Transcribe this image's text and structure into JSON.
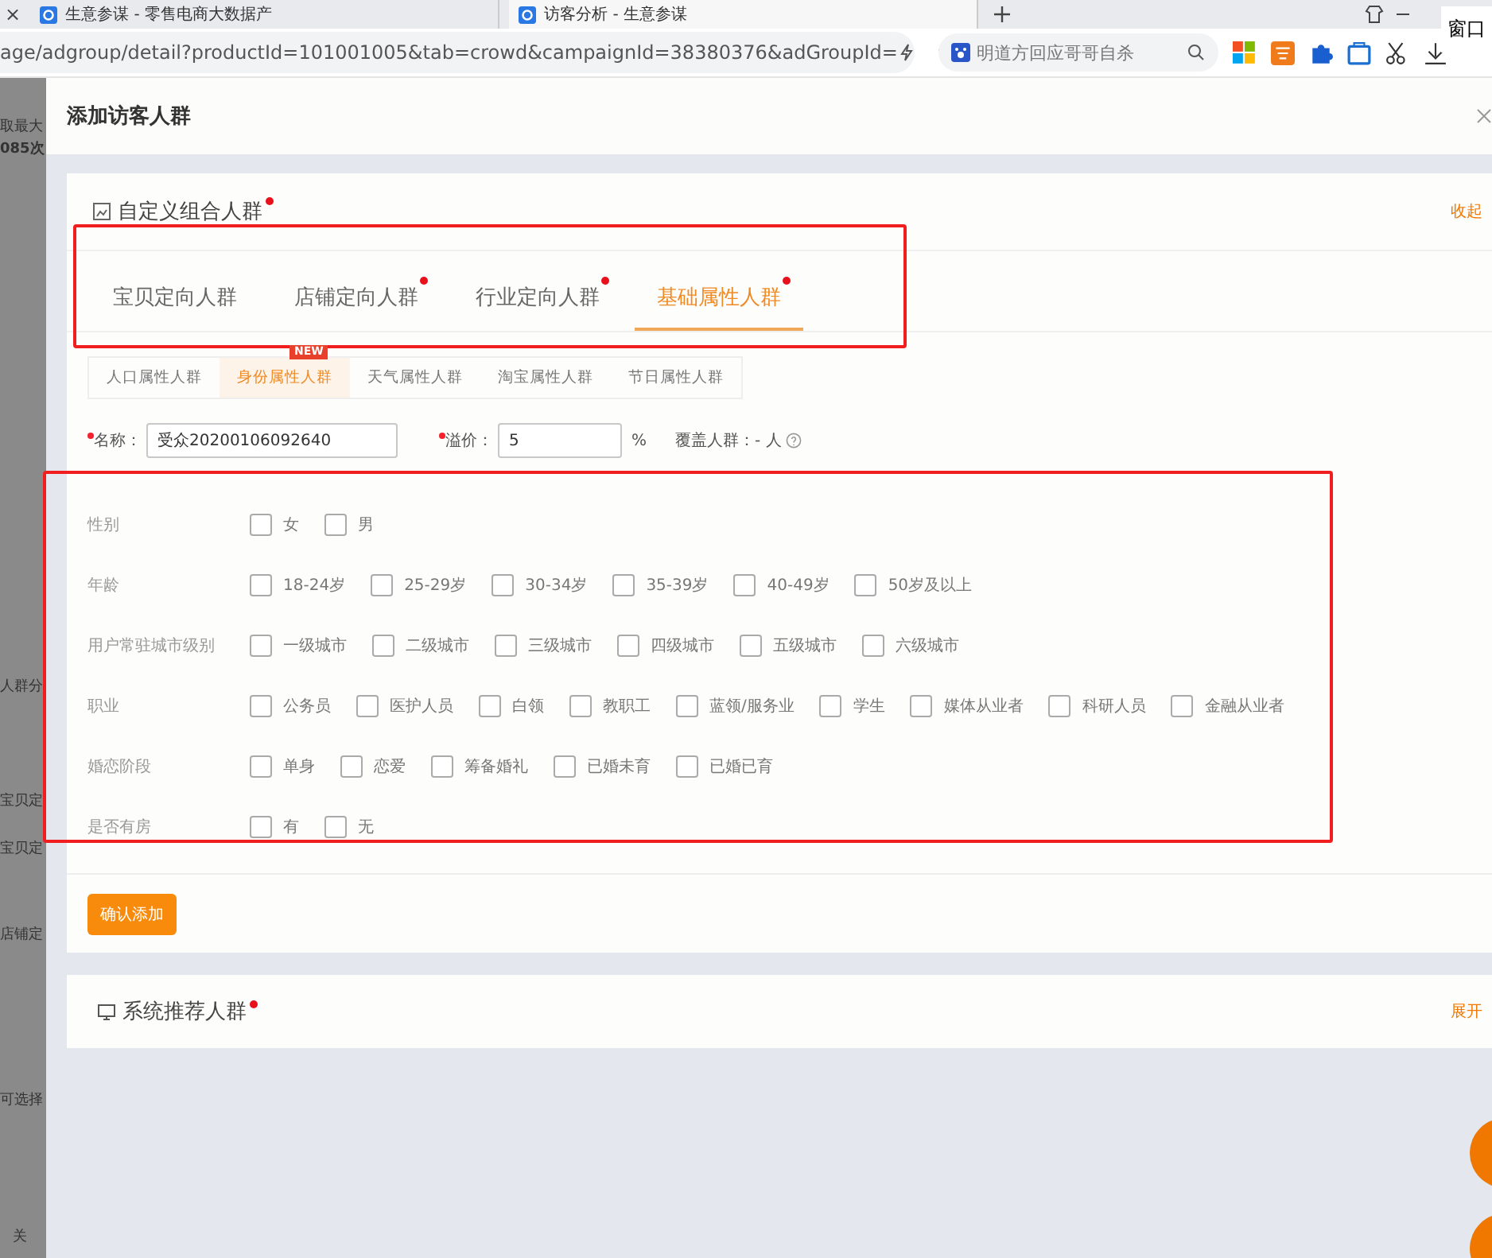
{
  "browser": {
    "close_tab": "×",
    "tabs": [
      {
        "title": "生意参谋 - 零售电商大数据产",
        "selected": false
      },
      {
        "title": "访客分析 - 生意参谋",
        "selected": true
      }
    ],
    "address": "age/adgroup/detail?productId=101001005&tab=crowd&campaignId=38380376&adGroupId=",
    "search": "明道方回应哥哥自杀",
    "window_label": "窗口"
  },
  "background_page": [
    "取最大",
    "085次",
    "人群分",
    "宝贝定",
    "宝贝定",
    "店铺定",
    "可选择",
    "关"
  ],
  "dialog": {
    "title": "添加访客人群",
    "custom_card": {
      "title": "自定义组合人群",
      "toggle": "收起",
      "tabs": [
        {
          "label": "宝贝定向人群",
          "selected": false,
          "dot": false
        },
        {
          "label": "店铺定向人群",
          "selected": false,
          "dot": true
        },
        {
          "label": "行业定向人群",
          "selected": false,
          "dot": true
        },
        {
          "label": "基础属性人群",
          "selected": true,
          "dot": true
        }
      ],
      "subtabs": [
        {
          "label": "人口属性人群",
          "selected": false
        },
        {
          "label": "身份属性人群",
          "selected": true,
          "badge": "NEW"
        },
        {
          "label": "天气属性人群",
          "selected": false
        },
        {
          "label": "淘宝属性人群",
          "selected": false
        },
        {
          "label": "节日属性人群",
          "selected": false
        }
      ],
      "name_label": "名称：",
      "name_value": "受众20200106092640",
      "premium_label": "溢价：",
      "premium_value": "5",
      "percent": "%",
      "coverage": "覆盖人群：- 人",
      "groups": [
        {
          "label": "性别",
          "options": [
            {
              "label": "女",
              "checked": false
            },
            {
              "label": "男",
              "checked": false
            }
          ]
        },
        {
          "label": "年龄",
          "options": [
            {
              "label": "18-24岁",
              "checked": false
            },
            {
              "label": "25-29岁",
              "checked": false
            },
            {
              "label": "30-34岁",
              "checked": false
            },
            {
              "label": "35-39岁",
              "checked": false
            },
            {
              "label": "40-49岁",
              "checked": false
            },
            {
              "label": "50岁及以上",
              "checked": false
            }
          ]
        },
        {
          "label": "用户常驻城市级别",
          "options": [
            {
              "label": "一级城市",
              "checked": false
            },
            {
              "label": "二级城市",
              "checked": false
            },
            {
              "label": "三级城市",
              "checked": false
            },
            {
              "label": "四级城市",
              "checked": false
            },
            {
              "label": "五级城市",
              "checked": false
            },
            {
              "label": "六级城市",
              "checked": false
            }
          ]
        },
        {
          "label": "职业",
          "options": [
            {
              "label": "公务员",
              "checked": false
            },
            {
              "label": "医护人员",
              "checked": false
            },
            {
              "label": "白领",
              "checked": false
            },
            {
              "label": "教职工",
              "checked": false
            },
            {
              "label": "蓝领/服务业",
              "checked": false
            },
            {
              "label": "学生",
              "checked": false
            },
            {
              "label": "媒体从业者",
              "checked": false
            },
            {
              "label": "科研人员",
              "checked": false
            },
            {
              "label": "金融从业者",
              "checked": false
            }
          ]
        },
        {
          "label": "婚恋阶段",
          "options": [
            {
              "label": "单身",
              "checked": false
            },
            {
              "label": "恋爱",
              "checked": false
            },
            {
              "label": "筹备婚礼",
              "checked": false
            },
            {
              "label": "已婚未育",
              "checked": false
            },
            {
              "label": "已婚已育",
              "checked": false
            }
          ]
        },
        {
          "label": "是否有房",
          "options": [
            {
              "label": "有",
              "checked": false
            },
            {
              "label": "无",
              "checked": false
            }
          ]
        }
      ],
      "confirm": "确认添加"
    },
    "recommend_card": {
      "title": "系统推荐人群",
      "toggle": "展开"
    }
  }
}
